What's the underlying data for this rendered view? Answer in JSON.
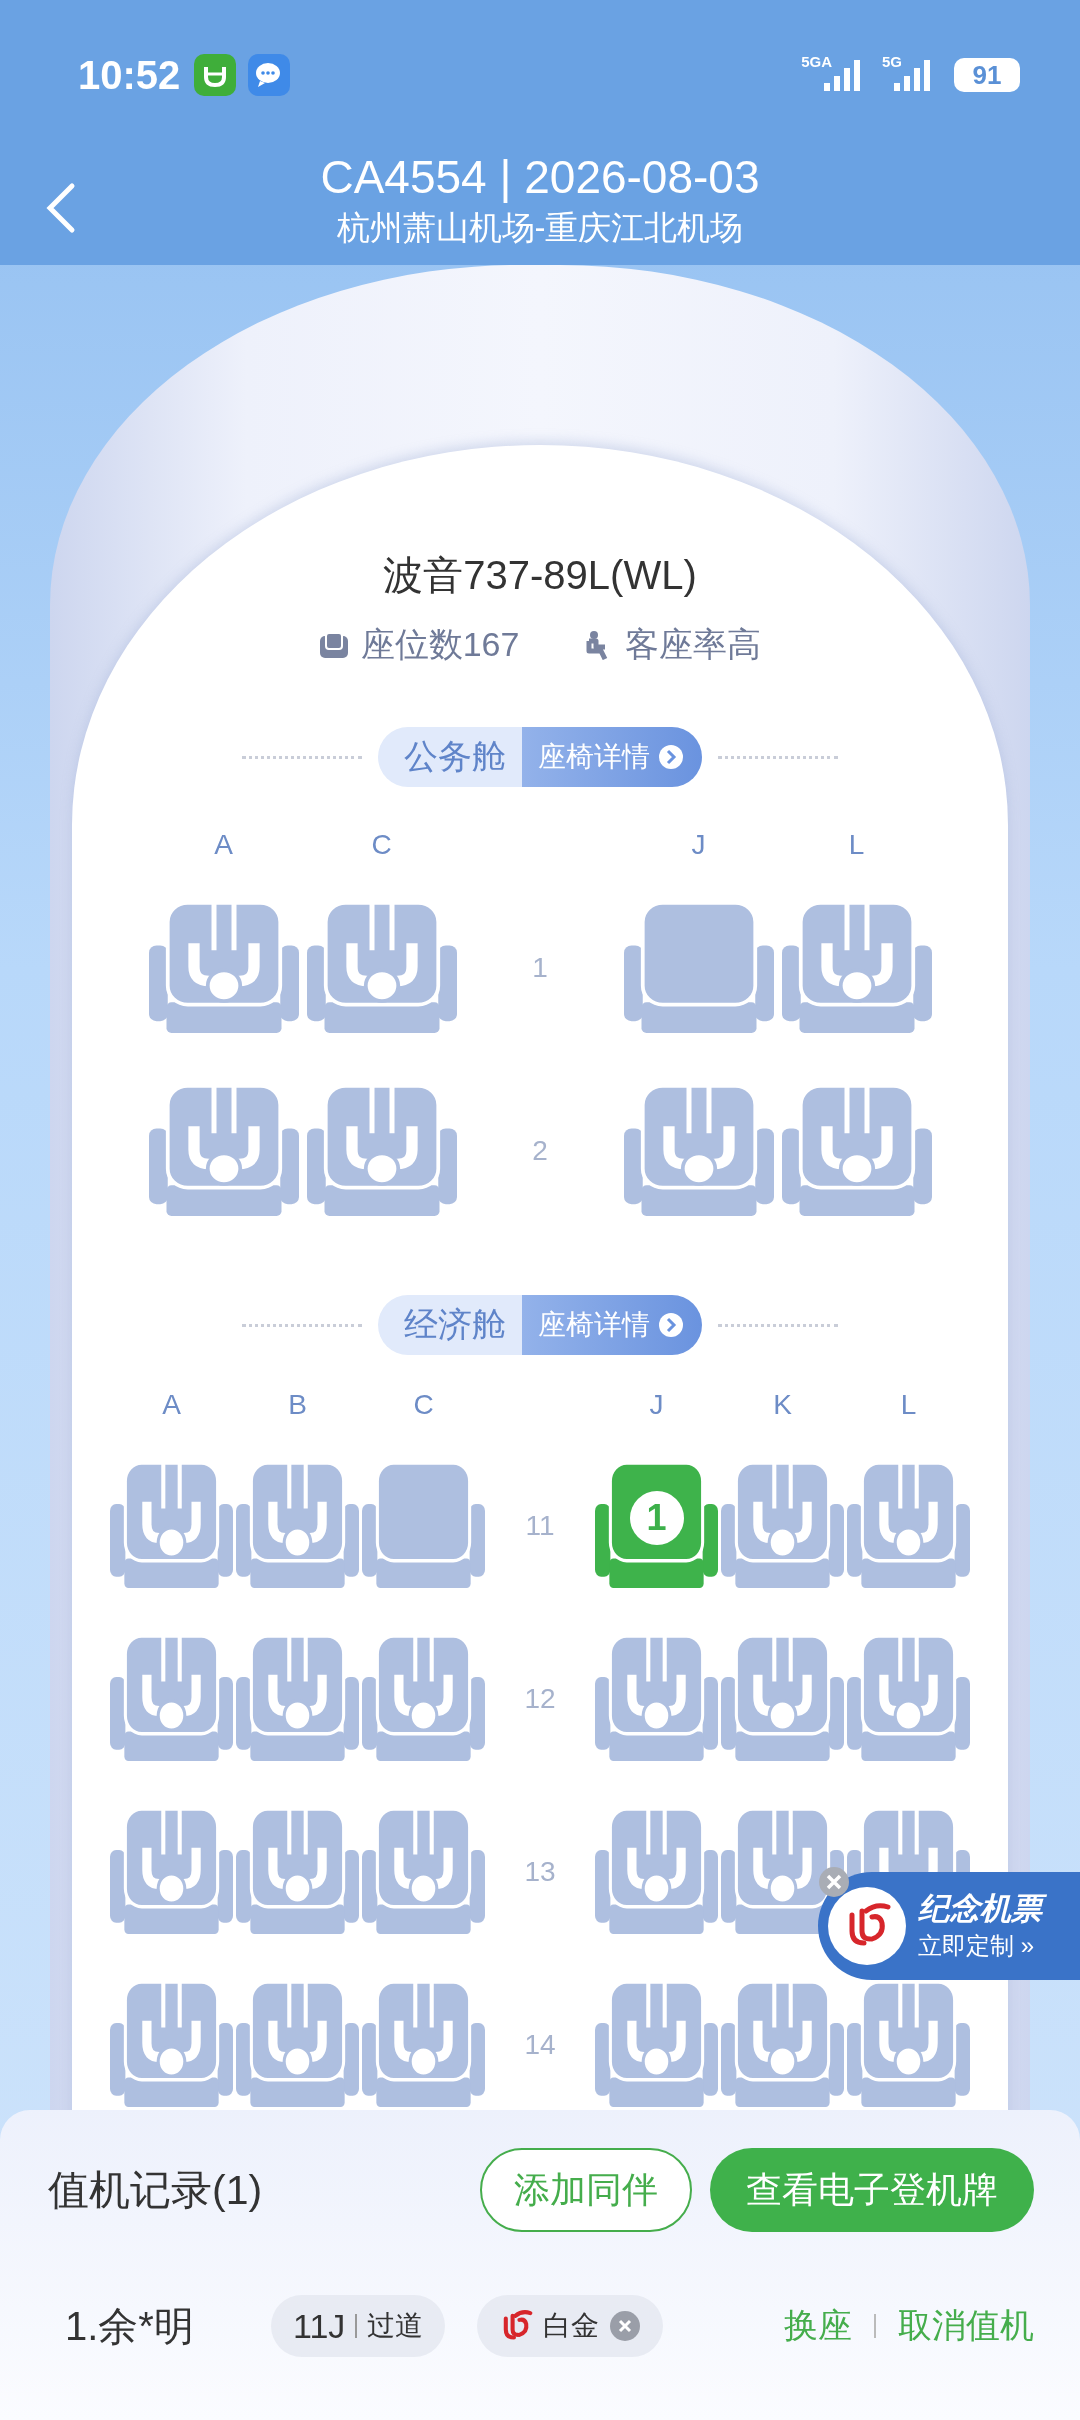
{
  "status_bar": {
    "time": "10:52",
    "network_1": "5GA",
    "network_2": "5G",
    "battery": "91"
  },
  "header": {
    "title": "CA4554 | 2026-08-03",
    "route": "杭州萧山机场-重庆江北机场"
  },
  "aircraft": {
    "model": "波音737-89L(WL)",
    "seat_count": "座位数167",
    "load_factor": "客座率高"
  },
  "cabins": [
    {
      "kind": "business",
      "name": "公务舱",
      "details_link": "座椅详情",
      "columns_left": [
        "A",
        "C"
      ],
      "columns_right": [
        "J",
        "L"
      ],
      "rows": [
        {
          "number": "1",
          "left": [
            {
              "occupied": true,
              "selected": false
            },
            {
              "occupied": true,
              "selected": false
            }
          ],
          "right": [
            {
              "occupied": false,
              "selected": false
            },
            {
              "occupied": true,
              "selected": false
            }
          ]
        },
        {
          "number": "2",
          "left": [
            {
              "occupied": true,
              "selected": false
            },
            {
              "occupied": true,
              "selected": false
            }
          ],
          "right": [
            {
              "occupied": true,
              "selected": false
            },
            {
              "occupied": true,
              "selected": false
            }
          ]
        }
      ]
    },
    {
      "kind": "economy",
      "name": "经济舱",
      "details_link": "座椅详情",
      "columns_left": [
        "A",
        "B",
        "C"
      ],
      "columns_right": [
        "J",
        "K",
        "L"
      ],
      "rows": [
        {
          "number": "11",
          "left": [
            {
              "occupied": true,
              "selected": false
            },
            {
              "occupied": true,
              "selected": false
            },
            {
              "occupied": false,
              "selected": false
            }
          ],
          "right": [
            {
              "occupied": false,
              "selected": true,
              "label": "1"
            },
            {
              "occupied": true,
              "selected": false
            },
            {
              "occupied": true,
              "selected": false
            }
          ]
        },
        {
          "number": "12",
          "left": [
            {
              "occupied": true,
              "selected": false
            },
            {
              "occupied": true,
              "selected": false
            },
            {
              "occupied": true,
              "selected": false
            }
          ],
          "right": [
            {
              "occupied": true,
              "selected": false
            },
            {
              "occupied": true,
              "selected": false
            },
            {
              "occupied": true,
              "selected": false
            }
          ]
        },
        {
          "number": "13",
          "left": [
            {
              "occupied": true,
              "selected": false
            },
            {
              "occupied": true,
              "selected": false
            },
            {
              "occupied": true,
              "selected": false
            }
          ],
          "right": [
            {
              "occupied": true,
              "selected": false
            },
            {
              "occupied": true,
              "selected": false
            },
            {
              "occupied": true,
              "selected": false
            }
          ]
        },
        {
          "number": "14",
          "left": [
            {
              "occupied": true,
              "selected": false
            },
            {
              "occupied": true,
              "selected": false
            },
            {
              "occupied": true,
              "selected": false
            }
          ],
          "right": [
            {
              "occupied": true,
              "selected": false
            },
            {
              "occupied": true,
              "selected": false
            },
            {
              "occupied": true,
              "selected": false
            }
          ]
        }
      ]
    }
  ],
  "promo": {
    "title": "纪念机票",
    "action": "立即定制 »"
  },
  "checkin": {
    "title": "值机记录(1)",
    "buttons": [
      {
        "kind": "outline",
        "label": "添加同伴"
      },
      {
        "kind": "primary",
        "label": "查看电子登机牌"
      }
    ],
    "passengers": [
      {
        "name": "1.余*明",
        "seat": "11J",
        "seat_type": "过道",
        "tier": "白金",
        "actions": [
          "换座",
          "取消值机"
        ]
      }
    ]
  }
}
